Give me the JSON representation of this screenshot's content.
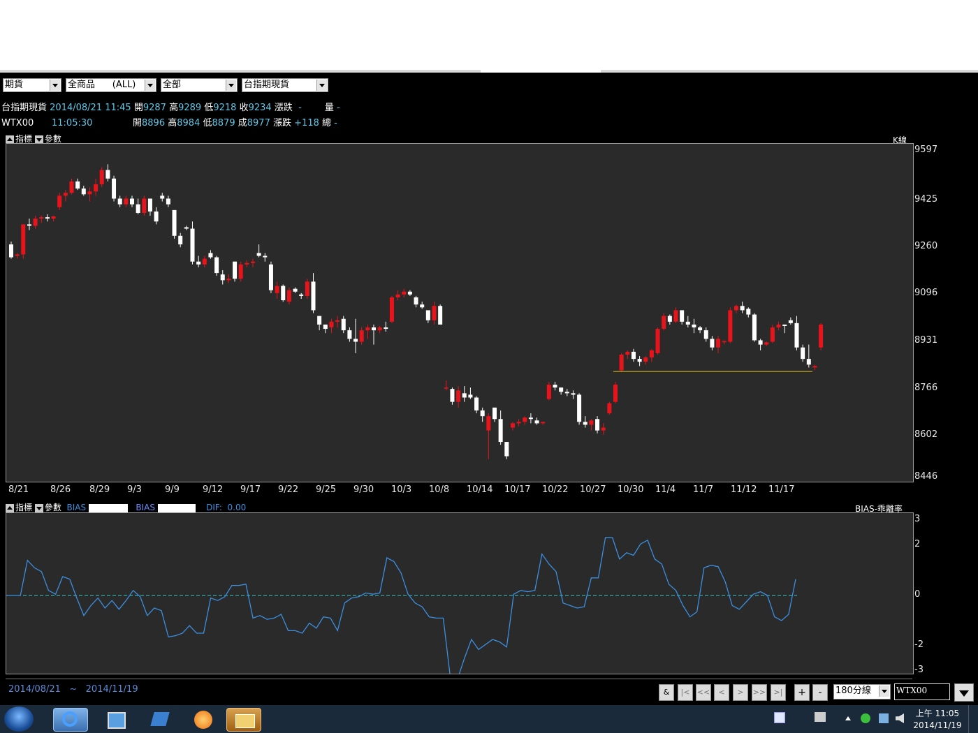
{
  "toolbar": {
    "sel1": "期貨",
    "sel2": "全商品      (ALL)",
    "sel3": "全部",
    "sel4": "台指期現貨"
  },
  "quote1": {
    "name": "台指期現貨",
    "datetime": "2014/08/21 11:45",
    "open_label": "開",
    "open": "9287",
    "high_label": "高",
    "high": "9289",
    "low_label": "低",
    "low": "9218",
    "close_label": "收",
    "close": "9234",
    "change_label": "漲跌",
    "change": "-",
    "vol_label": "量",
    "vol": "-"
  },
  "quote2": {
    "name": "WTX00",
    "time": "11:05:30",
    "open_label": "開",
    "open": "8896",
    "high_label": "高",
    "high": "8984",
    "low_label": "低",
    "low": "8879",
    "last_label": "成",
    "last": "8977",
    "change_label": "漲跌",
    "change": "+118",
    "total_label": "總",
    "total": "-"
  },
  "panel1": {
    "ind_label": "指標",
    "param_label": "參數",
    "type_label": "K線"
  },
  "panel2": {
    "ind_label": "指標",
    "param_label": "參數",
    "bias1": "BIAS",
    "bias2": "BIAS",
    "dif_label": "DIF:",
    "dif": "0.00",
    "title": "BIAS-乖離率"
  },
  "bottom": {
    "date_from": "2014/08/21",
    "sep": "~",
    "date_to": "2014/11/19",
    "amp": "&",
    "first": "|<",
    "prev_page": "<<",
    "prev": "<",
    "next": ">",
    "next_page": ">>",
    "last": ">|",
    "zoom_in": "+",
    "zoom_out": "-",
    "period": "180分線",
    "symbol": "WTX00"
  },
  "taskbar": {
    "time": "上午 11:05",
    "date": "2014/11/19"
  },
  "colors": {
    "up": "#e8141c",
    "down": "#ffffff",
    "bias_line": "#3b8fe0",
    "zero_line": "#41c6c6",
    "support": "#e0c020"
  },
  "chart_data": [
    {
      "type": "candlestick",
      "title": "",
      "ylim": [
        8446,
        9597
      ],
      "yticks": [
        9597,
        9425,
        9260,
        9096,
        8931,
        8766,
        8602,
        8446
      ],
      "xlabels": [
        "8/21",
        "8/26",
        "8/29",
        "9/3",
        "9/9",
        "9/12",
        "9/17",
        "9/22",
        "9/25",
        "9/30",
        "10/3",
        "10/8",
        "10/14",
        "10/17",
        "10/22",
        "10/27",
        "10/30",
        "11/4",
        "11/7",
        "11/12",
        "11/17"
      ],
      "support_level": 8826,
      "ohlc": [
        [
          9270,
          9280,
          9220,
          9225
        ],
        [
          9230,
          9240,
          9220,
          9235
        ],
        [
          9235,
          9340,
          9220,
          9340
        ],
        [
          9340,
          9360,
          9320,
          9335
        ],
        [
          9335,
          9370,
          9325,
          9360
        ],
        [
          9360,
          9370,
          9345,
          9365
        ],
        [
          9365,
          9375,
          9350,
          9360
        ],
        [
          9360,
          9370,
          9350,
          9368
        ],
        [
          9400,
          9450,
          9390,
          9440
        ],
        [
          9440,
          9460,
          9420,
          9450
        ],
        [
          9450,
          9500,
          9445,
          9490
        ],
        [
          9490,
          9500,
          9460,
          9465
        ],
        [
          9465,
          9475,
          9440,
          9445
        ],
        [
          9445,
          9470,
          9420,
          9455
        ],
        [
          9455,
          9500,
          9440,
          9480
        ],
        [
          9480,
          9540,
          9470,
          9530
        ],
        [
          9530,
          9550,
          9490,
          9500
        ],
        [
          9500,
          9510,
          9420,
          9430
        ],
        [
          9430,
          9440,
          9400,
          9410
        ],
        [
          9410,
          9440,
          9400,
          9430
        ],
        [
          9430,
          9440,
          9400,
          9410
        ],
        [
          9410,
          9430,
          9375,
          9380
        ],
        [
          9380,
          9440,
          9370,
          9430
        ],
        [
          9430,
          9420,
          9370,
          9385
        ],
        [
          9385,
          9400,
          9340,
          9350
        ],
        [
          9440,
          9450,
          9420,
          9430
        ],
        [
          9430,
          9440,
          9400,
          9410
        ],
        [
          9390,
          9380,
          9290,
          9300
        ],
        [
          9300,
          9310,
          9260,
          9270
        ],
        [
          9330,
          9335,
          9320,
          9325
        ],
        [
          9325,
          9350,
          9200,
          9210
        ],
        [
          9210,
          9230,
          9190,
          9200
        ],
        [
          9200,
          9230,
          9190,
          9220
        ],
        [
          9240,
          9250,
          9220,
          9225
        ],
        [
          9225,
          9230,
          9160,
          9170
        ],
        [
          9165,
          9180,
          9130,
          9145
        ],
        [
          9145,
          9165,
          9135,
          9150
        ],
        [
          9210,
          9210,
          9140,
          9150
        ],
        [
          9150,
          9210,
          9140,
          9200
        ],
        [
          9200,
          9215,
          9190,
          9205
        ],
        [
          9205,
          9220,
          9190,
          9210
        ],
        [
          9240,
          9270,
          9225,
          9230
        ],
        [
          9230,
          9240,
          9210,
          9225
        ],
        [
          9200,
          9210,
          9100,
          9110
        ],
        [
          9100,
          9140,
          9080,
          9125
        ],
        [
          9125,
          9130,
          9070,
          9075
        ],
        [
          9070,
          9120,
          9060,
          9110
        ],
        [
          9115,
          9120,
          9100,
          9105
        ],
        [
          9095,
          9100,
          9080,
          9090
        ],
        [
          9090,
          9150,
          9080,
          9140
        ],
        [
          9140,
          9170,
          9030,
          9040
        ],
        [
          9020,
          9020,
          8970,
          8990
        ],
        [
          8990,
          8990,
          8960,
          8975
        ],
        [
          8980,
          9010,
          8960,
          9000
        ],
        [
          9000,
          9020,
          8980,
          9005
        ],
        [
          9010,
          9020,
          8960,
          8970
        ],
        [
          8970,
          8980,
          8930,
          8940
        ],
        [
          8940,
          9010,
          8890,
          8930
        ],
        [
          8930,
          8980,
          8920,
          8970
        ],
        [
          8970,
          8990,
          8940,
          8980
        ],
        [
          8980,
          8990,
          8920,
          8970
        ],
        [
          8970,
          8985,
          8960,
          8980
        ],
        [
          8980,
          9000,
          8965,
          8975
        ],
        [
          9000,
          9090,
          8995,
          9085
        ],
        [
          9085,
          9110,
          9075,
          9095
        ],
        [
          9095,
          9115,
          9085,
          9105
        ],
        [
          9105,
          9110,
          9090,
          9095
        ],
        [
          9085,
          9090,
          9050,
          9060
        ],
        [
          9060,
          9070,
          9045,
          9050
        ],
        [
          9040,
          9035,
          8995,
          9005
        ],
        [
          9005,
          9070,
          8990,
          9055
        ],
        [
          9055,
          9060,
          9020,
          8990
        ],
        [
          8770,
          8795,
          8760,
          8770
        ],
        [
          8765,
          8770,
          8710,
          8720
        ],
        [
          8720,
          8775,
          8700,
          8760
        ],
        [
          8750,
          8775,
          8720,
          8735
        ],
        [
          8745,
          8770,
          8730,
          8735
        ],
        [
          8735,
          8740,
          8680,
          8690
        ],
        [
          8690,
          8700,
          8650,
          8670
        ],
        [
          8620,
          8680,
          8520,
          8670
        ],
        [
          8700,
          8700,
          8650,
          8660
        ],
        [
          8660,
          8690,
          8570,
          8580
        ],
        [
          8580,
          8580,
          8520,
          8530
        ],
        [
          8630,
          8650,
          8620,
          8645
        ],
        [
          8645,
          8660,
          8635,
          8650
        ],
        [
          8650,
          8670,
          8640,
          8665
        ],
        [
          8665,
          8680,
          8645,
          8660
        ],
        [
          8655,
          8665,
          8640,
          8645
        ],
        [
          8645,
          8650,
          8640,
          8650
        ],
        [
          8730,
          8790,
          8725,
          8780
        ],
        [
          8780,
          8790,
          8760,
          8770
        ],
        [
          8770,
          8770,
          8745,
          8755
        ],
        [
          8755,
          8765,
          8740,
          8750
        ],
        [
          8750,
          8760,
          8730,
          8745
        ],
        [
          8745,
          8750,
          8640,
          8650
        ],
        [
          8650,
          8670,
          8630,
          8640
        ],
        [
          8640,
          8660,
          8620,
          8655
        ],
        [
          8660,
          8670,
          8610,
          8620
        ],
        [
          8620,
          8645,
          8605,
          8630
        ],
        [
          8680,
          8720,
          8675,
          8715
        ],
        [
          8720,
          8790,
          8715,
          8780
        ],
        [
          8830,
          8890,
          8825,
          8885
        ],
        [
          8885,
          8900,
          8870,
          8895
        ],
        [
          8895,
          8905,
          8860,
          8870
        ],
        [
          8870,
          8880,
          8845,
          8860
        ],
        [
          8860,
          8880,
          8850,
          8875
        ],
        [
          8875,
          8905,
          8860,
          8900
        ],
        [
          8890,
          8980,
          8885,
          8975
        ],
        [
          8975,
          9030,
          8970,
          9020
        ],
        [
          9020,
          9025,
          8990,
          9000
        ],
        [
          9000,
          9050,
          8995,
          9040
        ],
        [
          9040,
          9040,
          8990,
          9000
        ],
        [
          9000,
          9020,
          8980,
          8990
        ],
        [
          8990,
          9010,
          8960,
          8980
        ],
        [
          8980,
          8985,
          8960,
          8970
        ],
        [
          8970,
          8980,
          8930,
          8940
        ],
        [
          8940,
          8950,
          8900,
          8910
        ],
        [
          8910,
          8950,
          8890,
          8940
        ],
        [
          8930,
          8935,
          8920,
          8932
        ],
        [
          8930,
          9050,
          8925,
          9040
        ],
        [
          9040,
          9060,
          9030,
          9055
        ],
        [
          9055,
          9070,
          9030,
          9040
        ],
        [
          9045,
          9050,
          9015,
          9025
        ],
        [
          9025,
          9030,
          8930,
          8935
        ],
        [
          8935,
          8940,
          8900,
          8920
        ],
        [
          8920,
          8930,
          8915,
          8928
        ],
        [
          8930,
          8990,
          8925,
          8980
        ],
        [
          8980,
          9000,
          8970,
          8990
        ],
        [
          8990,
          8990,
          8960,
          8985
        ],
        [
          9005,
          9015,
          8990,
          8995
        ],
        [
          8995,
          9020,
          8900,
          8910
        ],
        [
          8910,
          8920,
          8860,
          8870
        ],
        [
          8870,
          8920,
          8840,
          8850
        ],
        [
          8840,
          8850,
          8830,
          8845
        ],
        [
          8910,
          8995,
          8900,
          8990
        ]
      ]
    },
    {
      "type": "line",
      "title": "BIAS-乖離率",
      "ylim": [
        -3,
        3
      ],
      "yticks": [
        3,
        2,
        0,
        -2,
        -3
      ],
      "series": [
        {
          "name": "BIAS",
          "values": [
            0,
            0,
            0,
            1.4,
            1.1,
            0.95,
            0.2,
            0.05,
            0.75,
            0.65,
            -0.1,
            -0.8,
            -0.4,
            -0.1,
            -0.5,
            -0.2,
            -0.55,
            -0.2,
            0.2,
            -0.05,
            -0.8,
            -0.5,
            -0.6,
            -1.65,
            -1.6,
            -1.5,
            -1.2,
            -1.5,
            -1.5,
            -0.1,
            -0.2,
            -0.05,
            0.4,
            0.4,
            0.45,
            -0.9,
            -0.8,
            -0.95,
            -0.9,
            -0.75,
            -1.4,
            -1.4,
            -1.5,
            -1.1,
            -1.3,
            -0.85,
            -0.9,
            -1.4,
            -0.3,
            -0.1,
            -0.05,
            0.1,
            0.05,
            0.1,
            1.5,
            1.35,
            0.9,
            0.05,
            -0.3,
            -0.45,
            -0.85,
            -0.9,
            -0.9,
            -3.25,
            -3.35,
            -2.5,
            -1.75,
            -2.15,
            -1.95,
            -1.75,
            -1.85,
            -2.05,
            0.05,
            0.2,
            0.15,
            0.2,
            1.65,
            1.25,
            0.95,
            -0.3,
            -0.4,
            -0.5,
            -0.45,
            0.7,
            0.7,
            2.3,
            2.3,
            1.45,
            1.7,
            1.6,
            2.05,
            2.2,
            1.45,
            1.25,
            0.45,
            0.2,
            -0.4,
            -0.85,
            -0.65,
            1.1,
            1.2,
            1.15,
            0.55,
            -0.4,
            -0.55,
            -0.25,
            0.05,
            0.15,
            0.0,
            -0.85,
            -1.0,
            -0.75,
            0.65
          ]
        },
        {
          "name": "zero",
          "values": [
            0
          ]
        }
      ]
    }
  ]
}
